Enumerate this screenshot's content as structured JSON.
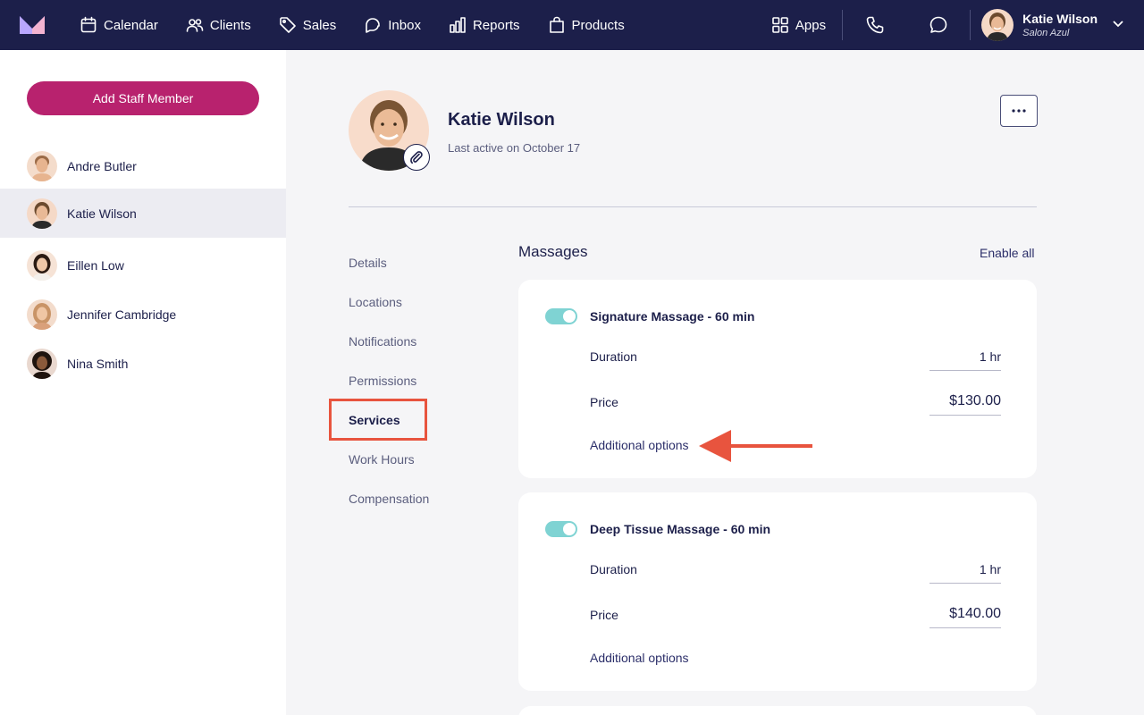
{
  "nav": {
    "items": [
      {
        "label": "Calendar",
        "icon": "calendar-icon"
      },
      {
        "label": "Clients",
        "icon": "users-icon"
      },
      {
        "label": "Sales",
        "icon": "tag-icon"
      },
      {
        "label": "Inbox",
        "icon": "inbox-icon"
      },
      {
        "label": "Reports",
        "icon": "bar-chart-icon"
      },
      {
        "label": "Products",
        "icon": "shopping-bag-icon"
      }
    ],
    "apps_label": "Apps",
    "user_name": "Katie Wilson",
    "user_salon": "Salon Azul"
  },
  "sidebar": {
    "add_button_label": "Add Staff Member",
    "staff": [
      {
        "name": "Andre Butler"
      },
      {
        "name": "Katie Wilson",
        "active": true
      },
      {
        "name": "Eillen Low"
      },
      {
        "name": "Jennifer Cambridge"
      },
      {
        "name": "Nina Smith"
      }
    ]
  },
  "profile": {
    "name": "Katie Wilson",
    "last_active": "Last active on October 17"
  },
  "settings_menu": {
    "items": [
      "Details",
      "Locations",
      "Notifications",
      "Permissions",
      "Services",
      "Work Hours",
      "Compensation"
    ],
    "active": "Services"
  },
  "services": {
    "section_title": "Massages",
    "enable_all_label": "Enable all",
    "cards": [
      {
        "name": "Signature Massage - 60 min",
        "enabled": true,
        "duration_label": "Duration",
        "duration": "1 hr",
        "price_label": "Price",
        "price": "$130.00",
        "options_label": "Additional options"
      },
      {
        "name": "Deep Tissue Massage - 60 min",
        "enabled": true,
        "duration_label": "Duration",
        "duration": "1 hr",
        "price_label": "Price",
        "price": "$140.00",
        "options_label": "Additional options"
      }
    ]
  },
  "colors": {
    "nav_bg": "#1c1f4a",
    "accent": "#b8226e",
    "toggle_on": "#7fd3d3",
    "annotation": "#e8543e"
  }
}
